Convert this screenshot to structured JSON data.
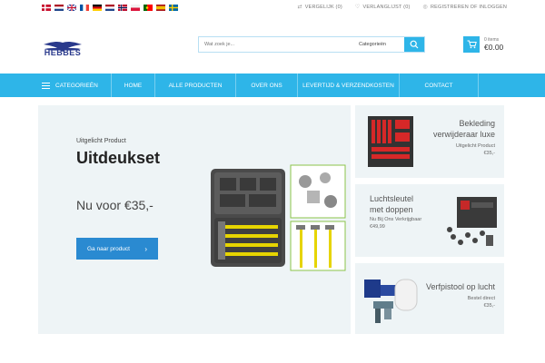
{
  "topbar": {
    "languages": [
      "Dansk",
      "English",
      "Français",
      "Deutsch",
      "Nederlands",
      "Norsk",
      "Polski",
      "Português",
      "Español",
      "Svenska"
    ],
    "compare": "VERGELIJK (0)",
    "wishlist": "VERLANGLIJST (0)",
    "account": "REGISTREREN OF INLOGGEN"
  },
  "header": {
    "logo_text": "HEBBES",
    "search_placeholder": "Wat zoek je...",
    "category_select": "Categorieën",
    "cart_items": "0 items",
    "cart_total": "€0.00"
  },
  "nav": {
    "categories": "CATEGORIEËN",
    "items": [
      "HOME",
      "ALLE PRODUCTEN",
      "OVER ONS",
      "LEVERTIJD & VERZENDKOSTEN",
      "CONTACT"
    ]
  },
  "hero": {
    "kicker": "Uitgelicht Product",
    "title": "Uitdeukset",
    "price": "Nu voor €35,-",
    "cta": "Ga naar product"
  },
  "cards": [
    {
      "name_line1": "Bekleding",
      "name_line2": "verwijderaar luxe",
      "sub1": "Uitgelicht Product",
      "sub2": "€35,-"
    },
    {
      "name_line1": "Luchtsleutel",
      "name_line2": "met doppen",
      "sub1": "Nu Bij Ons Verkrijgbaar",
      "sub2": "€49,99"
    },
    {
      "name_line1": "Verfpistool op lucht",
      "name_line2": "",
      "sub1": "Bestel direct",
      "sub2": "€35,-"
    }
  ],
  "colors": {
    "accent": "#2eb5e8",
    "cta": "#2a8ad1",
    "panel": "#eef4f6",
    "logo": "#2a3a8c"
  }
}
